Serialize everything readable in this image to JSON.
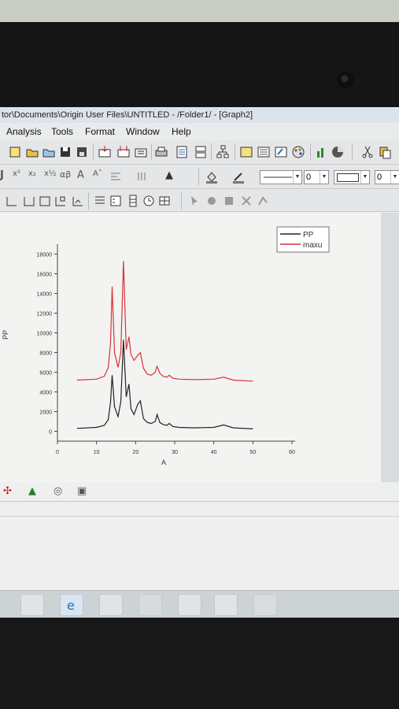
{
  "window": {
    "title": "tor\\Documents\\Origin User Files\\UNTITLED - /Folder1/ - [Graph2]"
  },
  "menu": {
    "items": [
      "Analysis",
      "Tools",
      "Format",
      "Window",
      "Help"
    ]
  },
  "toolbar": {
    "font_size_value": "0",
    "line_width_value": "0"
  },
  "icons": {
    "toolbar1": [
      "new-project-icon",
      "open-icon",
      "open-template-icon",
      "save-icon",
      "save-template-icon",
      "import-ascii-icon",
      "import-multiple-icon",
      "print-icon",
      "copy-page-icon",
      "project-explorer-icon",
      "results-log-icon",
      "command-window-icon",
      "code-builder-icon",
      "pie-color-icon",
      "paste-icon"
    ],
    "toolbar2": [
      "superscript-icon",
      "subscript-icon",
      "greek-icon",
      "increase-font-icon",
      "decrease-font-icon",
      "align-icon",
      "fill-color-icon",
      "line-color-icon"
    ],
    "toolbar3": [
      "layer-icon",
      "arrange-icon",
      "clock-icon",
      "table-icon",
      "pointer-icon",
      "data-reader-icon",
      "mask-icon"
    ],
    "taskbar": [
      "explorer-icon",
      "ie-icon",
      "paint-icon",
      "origin-icon",
      "folder-icon",
      "office-icon",
      "program-icon"
    ]
  },
  "chart_data": {
    "type": "line",
    "xlabel": "A",
    "ylabel": "PP",
    "xlim": [
      0,
      60
    ],
    "ylim": [
      -1000,
      19000
    ],
    "x_ticks": [
      "0",
      "10",
      "20",
      "30",
      "40",
      "50",
      "60"
    ],
    "y_ticks": [
      "0",
      "2000",
      "4000",
      "6000",
      "8000",
      "10000",
      "12000",
      "14000",
      "16000",
      "18000"
    ],
    "legend_position": "top-right",
    "series": [
      {
        "name": "PP",
        "color": "#222222",
        "x": [
          5,
          10,
          12,
          13,
          13.6,
          14,
          14.6,
          15.5,
          16.2,
          16.9,
          17.6,
          18.3,
          18.8,
          19.6,
          20.5,
          21.2,
          22,
          23,
          24,
          25,
          25.5,
          26.2,
          27,
          28,
          28.6,
          29.5,
          31,
          35,
          40,
          42.5,
          45,
          50
        ],
        "y": [
          300,
          400,
          600,
          1200,
          3000,
          5700,
          2500,
          1500,
          3000,
          9300,
          3500,
          4800,
          2300,
          1700,
          2700,
          3100,
          1300,
          900,
          800,
          1000,
          1700,
          900,
          700,
          600,
          800,
          500,
          400,
          350,
          400,
          650,
          350,
          250
        ]
      },
      {
        "name": "maxu",
        "color": "#d9333b",
        "x": [
          5,
          10,
          12,
          13,
          13.6,
          14,
          14.6,
          15.5,
          16.2,
          16.9,
          17.6,
          18.3,
          18.8,
          19.6,
          20.5,
          21.2,
          22,
          23,
          24,
          25,
          25.5,
          26.2,
          27,
          28,
          28.6,
          29.5,
          31,
          35,
          40,
          42.5,
          45,
          50
        ],
        "y": [
          5200,
          5300,
          5600,
          6500,
          9000,
          14700,
          8000,
          6500,
          8000,
          17300,
          8300,
          9600,
          7800,
          7200,
          7700,
          8000,
          6400,
          5800,
          5700,
          6000,
          6600,
          5900,
          5600,
          5500,
          5700,
          5400,
          5300,
          5250,
          5300,
          5500,
          5200,
          5100
        ]
      }
    ]
  }
}
